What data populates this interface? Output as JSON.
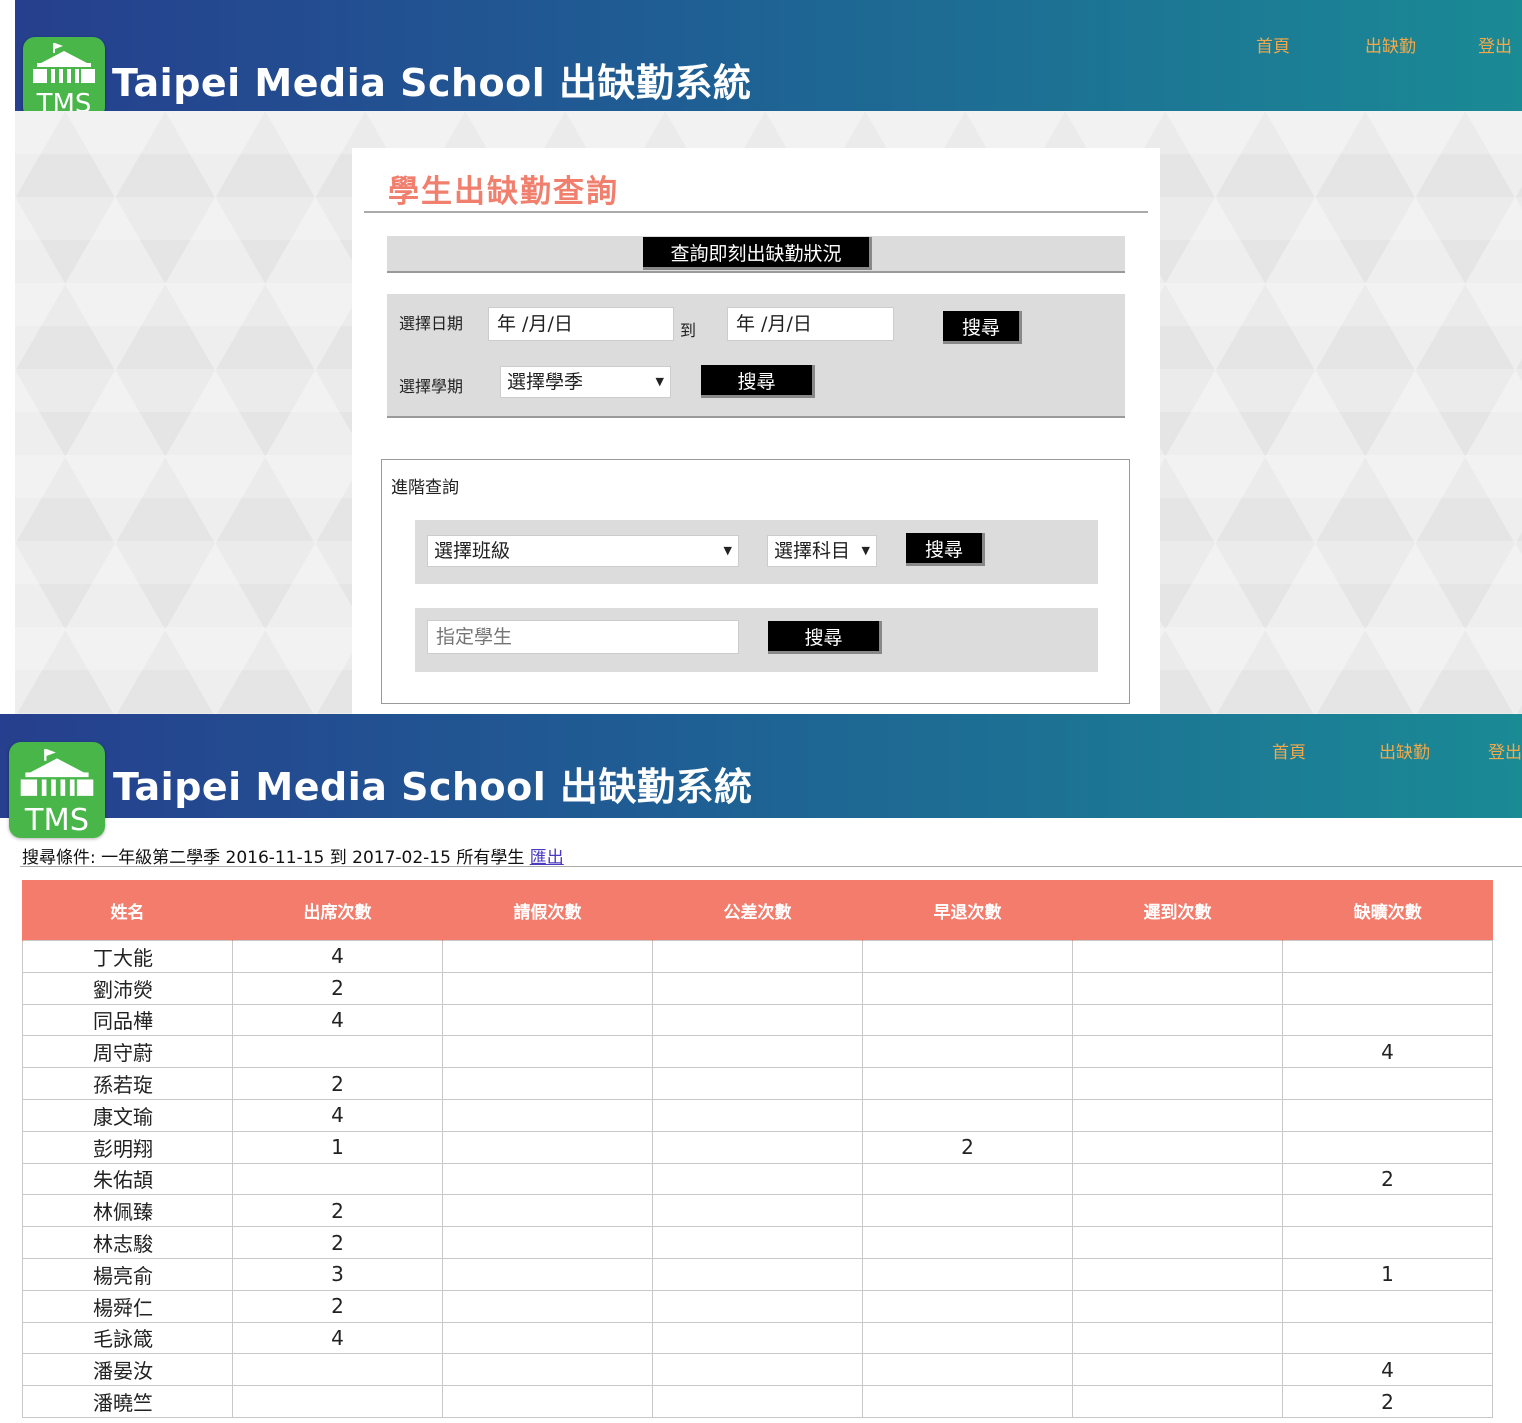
{
  "top_header": {
    "logo_text": "TMS",
    "brand": "Taipei Media School 出缺勤系統",
    "nav": [
      "首頁",
      "出缺勤",
      "登出"
    ]
  },
  "query_panel": {
    "title": "學生出缺勤查詢",
    "realtime_button": "查詢即刻出缺勤狀況",
    "date_label": "選擇日期",
    "date_from": "年 /月/日",
    "date_to_label": "到",
    "date_to": "年 /月/日",
    "date_search": "搜尋",
    "term_label": "選擇學期",
    "term_select": "選擇學季",
    "term_search": "搜尋",
    "advanced_title": "進階查詢",
    "class_select": "選擇班級",
    "subject_select": "選擇科目",
    "class_search": "搜尋",
    "student_placeholder": "指定學生",
    "student_search": "搜尋"
  },
  "bottom_header": {
    "logo_text": "TMS",
    "brand": "Taipei Media School 出缺勤系統",
    "nav": [
      "首頁",
      "出缺勤",
      "登出"
    ]
  },
  "results": {
    "criteria": "搜尋條件: 一年級第二學季 2016-11-15 到 2017-02-15 所有學生",
    "export_link": "匯出",
    "columns": [
      "姓名",
      "出席次數",
      "請假次數",
      "公差次數",
      "早退次數",
      "遲到次數",
      "缺曠次數"
    ],
    "rows": [
      [
        "丁大能",
        "4",
        "",
        "",
        "",
        "",
        ""
      ],
      [
        "劉沛熒",
        "2",
        "",
        "",
        "",
        "",
        ""
      ],
      [
        "同品樺",
        "4",
        "",
        "",
        "",
        "",
        ""
      ],
      [
        "周守蔚",
        "",
        "",
        "",
        "",
        "",
        "4"
      ],
      [
        "孫若琁",
        "2",
        "",
        "",
        "",
        "",
        ""
      ],
      [
        "康文瑜",
        "4",
        "",
        "",
        "",
        "",
        ""
      ],
      [
        "彭明翔",
        "1",
        "",
        "",
        "2",
        "",
        ""
      ],
      [
        "朱佑頡",
        "",
        "",
        "",
        "",
        "",
        "2"
      ],
      [
        "林佩臻",
        "2",
        "",
        "",
        "",
        "",
        ""
      ],
      [
        "林志駿",
        "2",
        "",
        "",
        "",
        "",
        ""
      ],
      [
        "楊亮俞",
        "3",
        "",
        "",
        "",
        "",
        "1"
      ],
      [
        "楊舜仁",
        "2",
        "",
        "",
        "",
        "",
        ""
      ],
      [
        "毛詠箴",
        "4",
        "",
        "",
        "",
        "",
        ""
      ],
      [
        "潘晏汝",
        "",
        "",
        "",
        "",
        "",
        "4"
      ],
      [
        "潘曉竺",
        "",
        "",
        "",
        "",
        "",
        "2"
      ]
    ]
  },
  "colors": {
    "header_start": "#263f8e",
    "header_end": "#1a8a95",
    "nav_link": "#f2a94b",
    "title_accent": "#f07f6e",
    "table_header": "#f47c6c",
    "logo_green": "#49b649"
  }
}
